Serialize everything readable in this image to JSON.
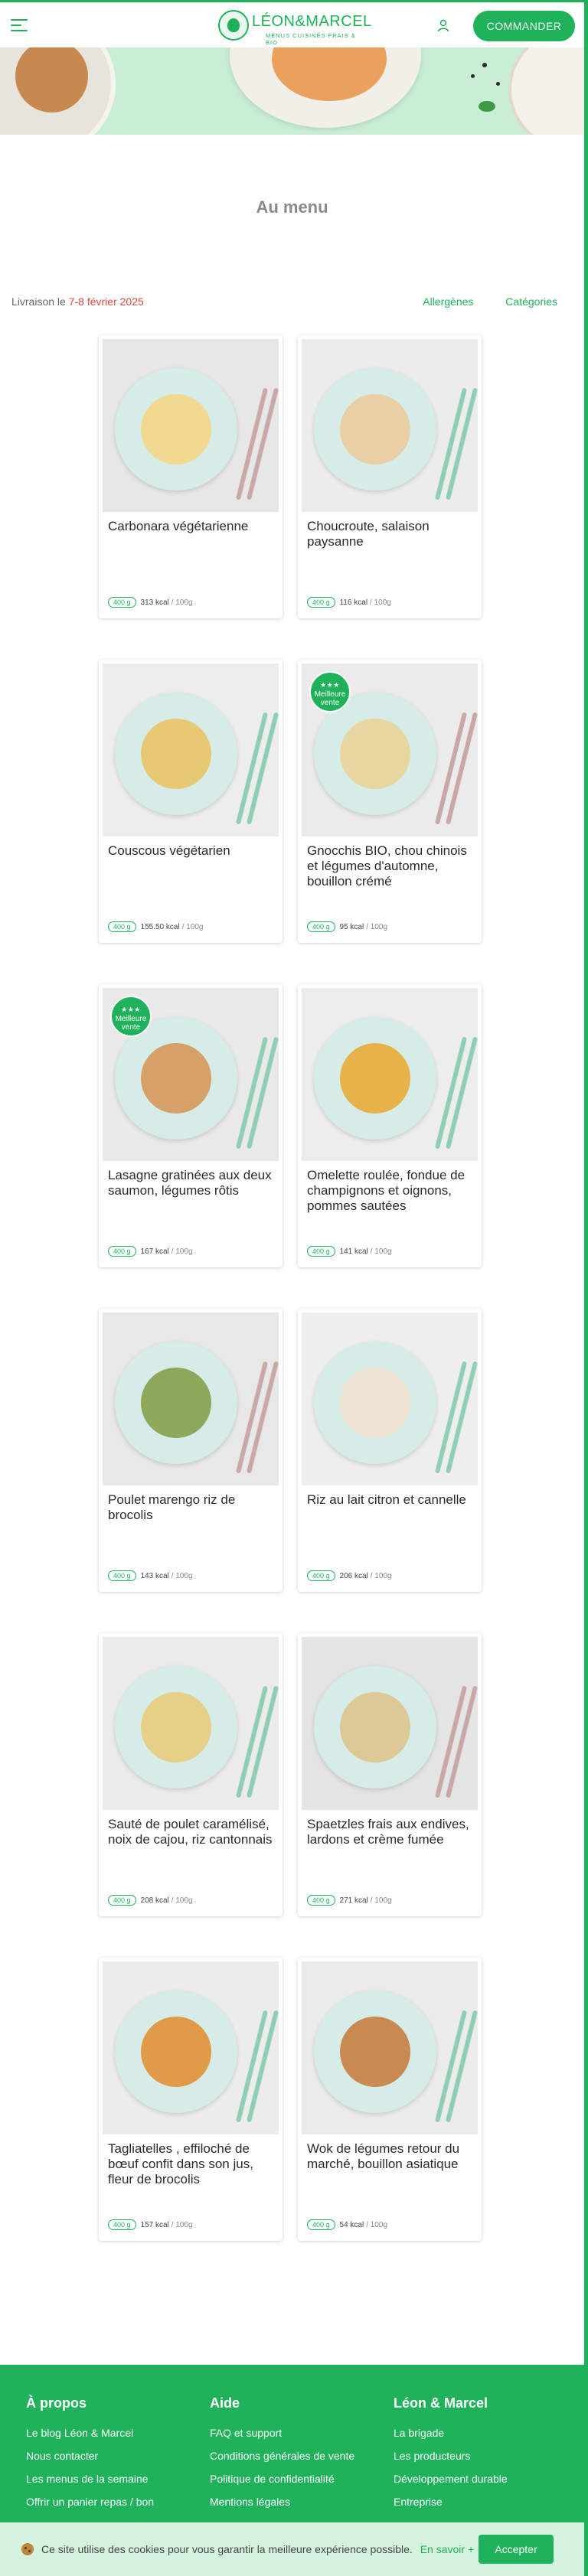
{
  "header": {
    "logo_name": "LÉON&MARCEL",
    "logo_tagline": "MENUS CUISINÉS FRAIS & BIO",
    "cta_label": "COMMANDER"
  },
  "hero": {
    "title": "Au menu"
  },
  "delivery": {
    "prefix": "Livraison le",
    "date": "7-8 février 2025"
  },
  "filters": {
    "allergens": "Allergènes",
    "categories": "Catégories"
  },
  "badge": {
    "stars": "★★★",
    "text_line1": "Meilleure",
    "text_line2": "vente"
  },
  "dishes": [
    {
      "title": "Carbonara végétarienne",
      "weight": "400 g",
      "kcal": "313 kcal",
      "unit": "/ 100g",
      "best_seller": false,
      "food_color": "#f1d98f",
      "bg": "#e7e7e7"
    },
    {
      "title": "Choucroute, salaison paysanne",
      "weight": "400 g",
      "kcal": "116 kcal",
      "unit": "/ 100g",
      "best_seller": false,
      "food_color": "#e9cfa5",
      "bg": "#ececec"
    },
    {
      "title": "Couscous végétarien",
      "weight": "400 g",
      "kcal": "155.50 kcal",
      "unit": "/ 100g",
      "best_seller": false,
      "food_color": "#e7c973",
      "bg": "#ededed"
    },
    {
      "title": "Gnocchis BIO, chou chinois et légumes d'automne, bouillon crémé",
      "weight": "400 g",
      "kcal": "95 kcal",
      "unit": "/ 100g",
      "best_seller": true,
      "food_color": "#e8d6a0",
      "bg": "#ebebeb"
    },
    {
      "title": "Lasagne gratinées aux deux saumon, légumes rôtis",
      "weight": "400 g",
      "kcal": "167 kcal",
      "unit": "/ 100g",
      "best_seller": true,
      "food_color": "#d7a066",
      "bg": "#e9e9e9"
    },
    {
      "title": "Omelette roulée, fondue de champignons et oignons, pommes sautées",
      "weight": "400 g",
      "kcal": "141 kcal",
      "unit": "/ 100g",
      "best_seller": false,
      "food_color": "#e7b24a",
      "bg": "#ededed"
    },
    {
      "title": "Poulet marengo riz de brocolis",
      "weight": "400 g",
      "kcal": "143 kcal",
      "unit": "/ 100g",
      "best_seller": false,
      "food_color": "#8ea75a",
      "bg": "#e8e8e8"
    },
    {
      "title": "Riz au lait citron et cannelle",
      "weight": "400 g",
      "kcal": "206 kcal",
      "unit": "/ 100g",
      "best_seller": false,
      "food_color": "#efe4d2",
      "bg": "#eeeeee"
    },
    {
      "title": "Sauté de poulet caramélisé, noix de cajou, riz cantonnais",
      "weight": "400 g",
      "kcal": "208 kcal",
      "unit": "/ 100g",
      "best_seller": false,
      "food_color": "#e6cf86",
      "bg": "#ebebeb"
    },
    {
      "title": "Spaetzles frais aux endives, lardons et crème fumée",
      "weight": "400 g",
      "kcal": "271 kcal",
      "unit": "/ 100g",
      "best_seller": false,
      "food_color": "#dcc995",
      "bg": "#e4e4e4"
    },
    {
      "title": "Tagliatelles , effiloché de bœuf confit dans son jus, fleur de brocolis",
      "weight": "400 g",
      "kcal": "157 kcal",
      "unit": "/ 100g",
      "best_seller": false,
      "food_color": "#e19a48",
      "bg": "#ececec"
    },
    {
      "title": "Wok de légumes retour du marché, bouillon asiatique",
      "weight": "400 g",
      "kcal": "54 kcal",
      "unit": "/ 100g",
      "best_seller": false,
      "food_color": "#c98a52",
      "bg": "#ebebeb"
    }
  ],
  "footer": {
    "columns": [
      {
        "title": "À propos",
        "links": [
          "Le blog Léon & Marcel",
          "Nous contacter",
          "Les menus de la semaine",
          "Offrir un panier repas / bon"
        ]
      },
      {
        "title": "Aide",
        "links": [
          "FAQ et support",
          "Conditions générales de vente",
          "Politique de confidentialité",
          "Mentions légales"
        ]
      },
      {
        "title": "Léon & Marcel",
        "links": [
          "La brigade",
          "Les producteurs",
          "Développement durable",
          "Entreprise"
        ]
      }
    ]
  },
  "cookie": {
    "text": "Ce site utilise des cookies pour vous garantir la meilleure expérience possible.",
    "link": "En savoir +",
    "button": "Accepter"
  },
  "colors": {
    "accent": "#1fb25a",
    "date": "#e2483d",
    "hero_bg": "#c8efd6",
    "cookie_bg": "#d5f2df"
  }
}
